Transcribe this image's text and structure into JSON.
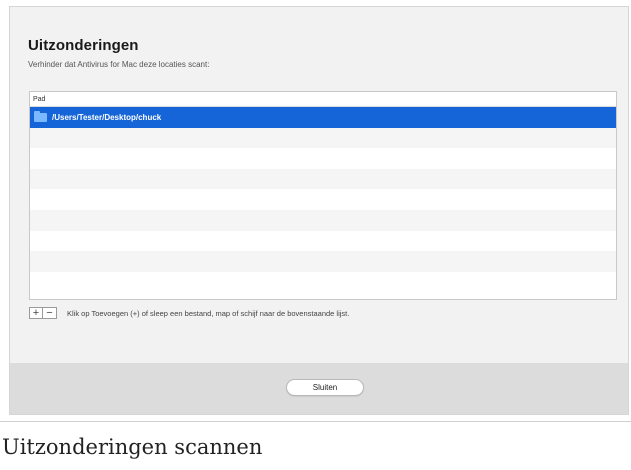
{
  "dialog": {
    "title": "Uitzonderingen",
    "subtitle": "Verhinder dat Antivirus for Mac deze locaties scant:",
    "table": {
      "column_header": "Pad",
      "rows": [
        {
          "path": "/Users/Tester/Desktop/chuck",
          "icon": "folder-icon",
          "selected": true
        }
      ],
      "empty_row_count": 8
    },
    "controls": {
      "add_label": "+",
      "remove_label": "−",
      "hint": "Klik op Toevoegen (+) of sleep een bestand, map of schijf naar de bovenstaande lijst."
    },
    "footer": {
      "close_label": "Sluiten"
    }
  },
  "caption": "Uitzonderingen scannen",
  "colors": {
    "selection": "#1565d8",
    "folder": "#3b8ef0"
  }
}
